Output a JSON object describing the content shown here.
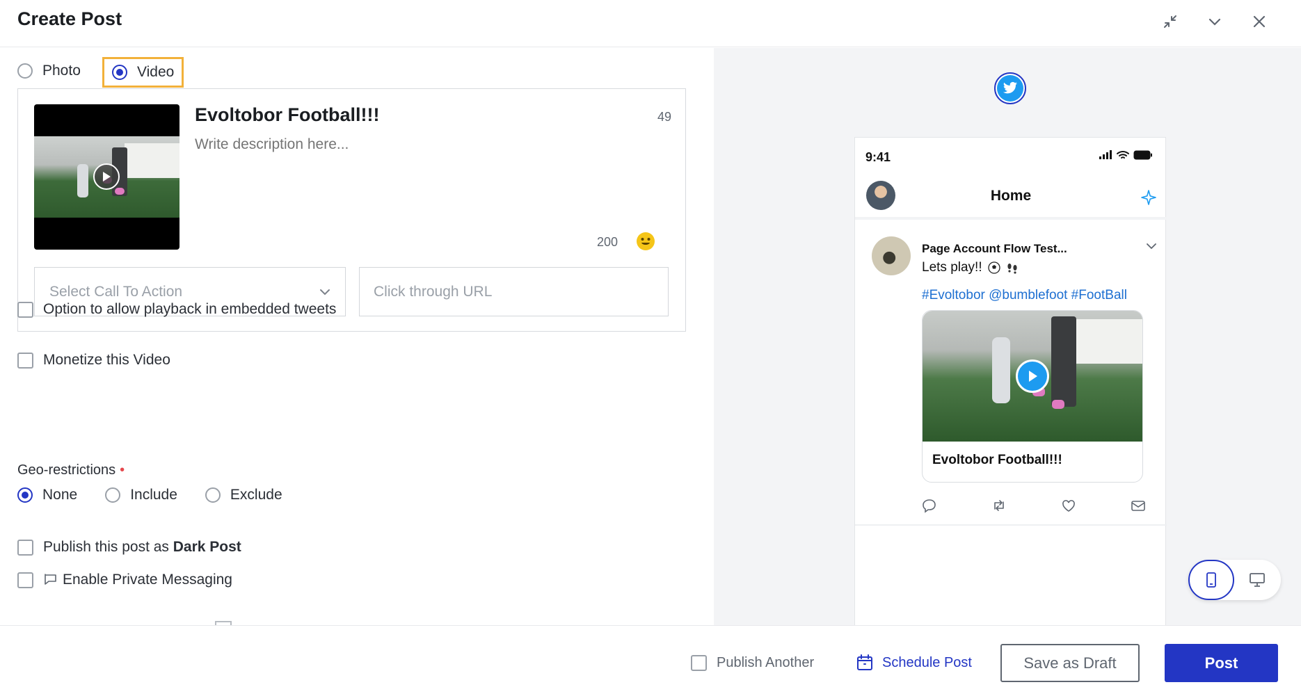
{
  "header": {
    "title": "Create Post"
  },
  "media_type": {
    "options": [
      {
        "label": "Photo",
        "selected": false
      },
      {
        "label": "Video",
        "selected": true
      }
    ]
  },
  "composer": {
    "title": "Evoltobor Football!!!",
    "title_remaining": "49",
    "description_placeholder": "Write description here...",
    "description_remaining": "200",
    "cta_placeholder": "Select Call To Action",
    "url_placeholder": "Click through URL"
  },
  "options": {
    "embedded_playback": "Option to allow playback in embedded tweets",
    "monetize": "Monetize this Video",
    "dark_post_prefix": "Publish this post as ",
    "dark_post_bold": "Dark Post",
    "private_messaging": "Enable Private Messaging"
  },
  "geo": {
    "label": "Geo-restrictions",
    "required_mark": "•",
    "options": [
      {
        "label": "None",
        "selected": true
      },
      {
        "label": "Include",
        "selected": false
      },
      {
        "label": "Exclude",
        "selected": false
      }
    ]
  },
  "preview": {
    "network_icon": "twitter-bird-icon",
    "status_time": "9:41",
    "home_title": "Home",
    "tweet": {
      "author": "Page Account Flow Test...",
      "text": "Lets play!!",
      "text_emojis": [
        "soccer-ball-icon",
        "footprints-icon"
      ],
      "hashtags": "#Evoltobor @bumblefoot #FootBall",
      "card_title": "Evoltobor Football!!!"
    }
  },
  "footer": {
    "publish_another": "Publish Another",
    "schedule": "Schedule Post",
    "save_draft": "Save as Draft",
    "post": "Post"
  },
  "colors": {
    "primary": "#2336c4",
    "highlight": "#f2b13a",
    "twitter_blue": "#1d9bf0",
    "hashtag_blue": "#1d6fd1"
  }
}
